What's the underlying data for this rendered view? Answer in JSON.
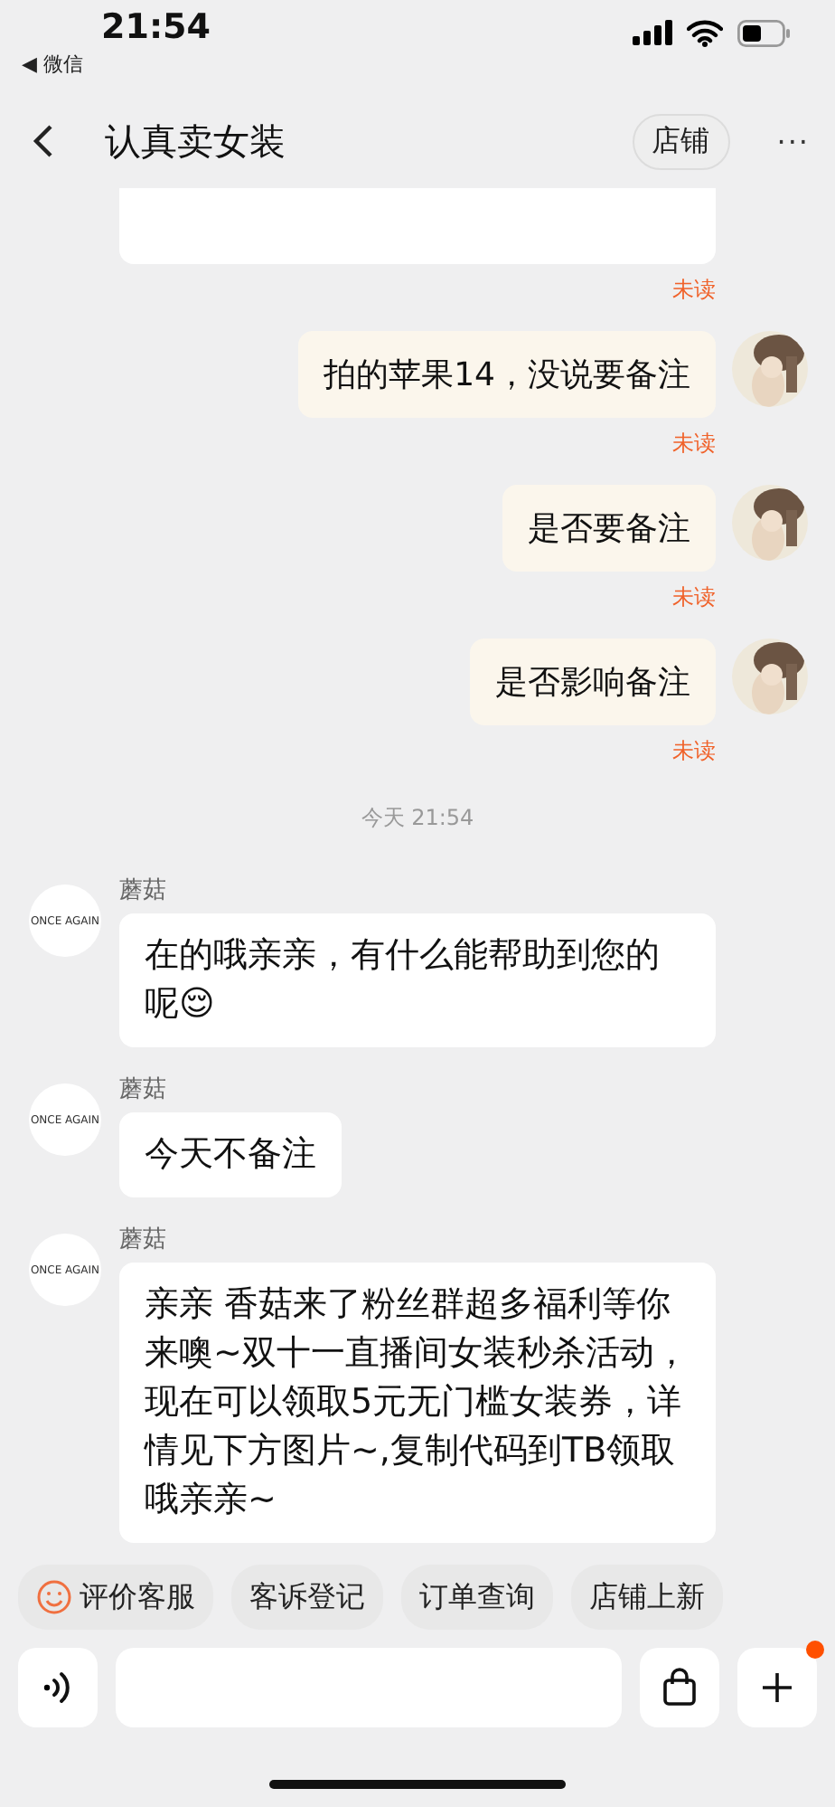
{
  "status_bar": {
    "time": "21:54",
    "back_app": "◀ 微信"
  },
  "header": {
    "title": "认真卖女装",
    "shop_button": "店铺",
    "more": "···"
  },
  "messages": [
    {
      "kind": "card",
      "status": "未读"
    },
    {
      "kind": "sent",
      "text": "拍的苹果14，没说要备注",
      "status": "未读"
    },
    {
      "kind": "sent",
      "text": "是否要备注",
      "status": "未读"
    },
    {
      "kind": "sent",
      "text": "是否影响备注",
      "status": "未读"
    },
    {
      "kind": "time",
      "text": "今天 21:54"
    },
    {
      "kind": "received",
      "sender": "蘑菇",
      "avatar_text": "ONCE AGAIN",
      "text": "在的哦亲亲，有什么能帮助到您的呢😌"
    },
    {
      "kind": "received",
      "sender": "蘑菇",
      "avatar_text": "ONCE AGAIN",
      "text": "今天不备注"
    },
    {
      "kind": "received",
      "sender": "蘑菇",
      "avatar_text": "ONCE AGAIN",
      "text": "亲亲 香菇来了粉丝群超多福利等你来噢~双十一直播间女装秒杀活动，现在可以领取5元无门槛女装券，详情见下方图片~,复制代码到TB领取哦亲亲~"
    }
  ],
  "quick_actions": [
    {
      "label": "评价客服",
      "icon": true
    },
    {
      "label": "客诉登记",
      "icon": false
    },
    {
      "label": "订单查询",
      "icon": false
    },
    {
      "label": "店铺上新",
      "icon": false
    }
  ],
  "input_bar": {
    "plus_badge": true
  }
}
